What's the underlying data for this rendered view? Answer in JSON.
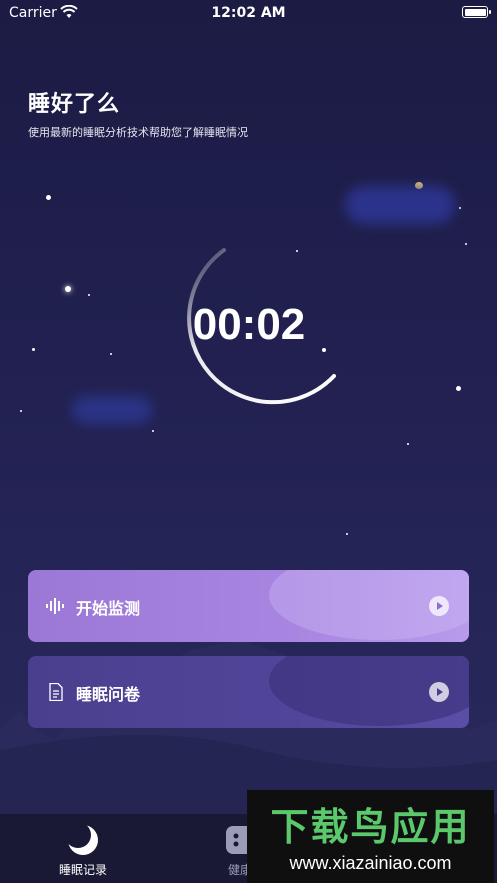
{
  "status_bar": {
    "carrier": "Carrier",
    "time": "12:02 AM"
  },
  "header": {
    "title": "睡好了么",
    "subtitle": "使用最新的睡眠分析技术帮助您了解睡眠情况"
  },
  "timer": {
    "value": "00:02",
    "ring_progress": 0.72
  },
  "actions": [
    {
      "label": "开始监测",
      "icon": "sound-wave-icon"
    },
    {
      "label": "睡眠问卷",
      "icon": "document-icon"
    }
  ],
  "tab_bar": {
    "tabs": [
      {
        "label": "睡眠记录",
        "icon": "moon-icon",
        "active": true
      },
      {
        "label": "健康",
        "icon": "grid-icon",
        "active": false
      }
    ]
  },
  "watermark": {
    "title": "下载鸟应用",
    "url": "www.xiazainiao.com"
  },
  "colors": {
    "background": "#1b1b44",
    "accent_purple": "#a885e0",
    "survey_purple": "#4a3f8e",
    "tab_bar": "#191935"
  }
}
